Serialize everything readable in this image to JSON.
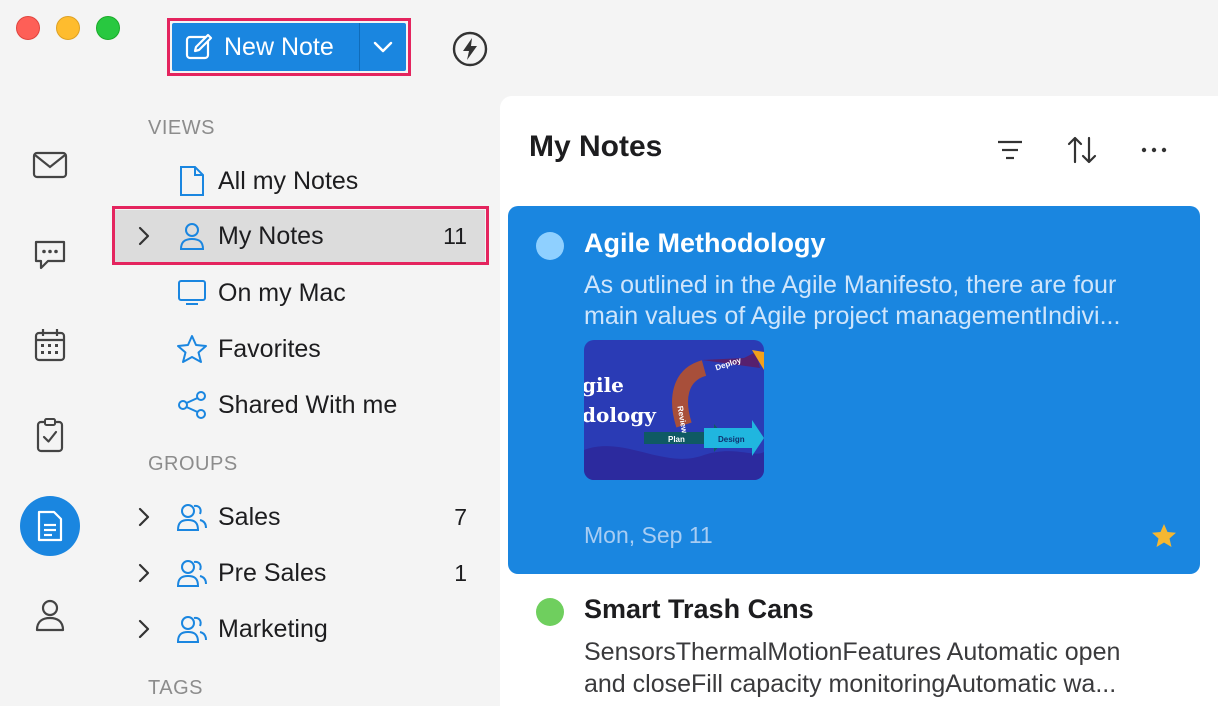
{
  "toolbar": {
    "new_note_label": "New Note"
  },
  "sidebar": {
    "views_header": "VIEWS",
    "views": [
      {
        "label": "All my Notes",
        "icon": "document-icon"
      },
      {
        "label": "My Notes",
        "icon": "person-icon",
        "count": "11"
      },
      {
        "label": "On my Mac",
        "icon": "monitor-icon"
      },
      {
        "label": "Favorites",
        "icon": "star-icon"
      },
      {
        "label": "Shared With me",
        "icon": "share-icon"
      }
    ],
    "groups_header": "GROUPS",
    "groups": [
      {
        "label": "Sales",
        "count": "7"
      },
      {
        "label": "Pre Sales",
        "count": "1"
      },
      {
        "label": "Marketing"
      }
    ],
    "tags_header": "TAGS"
  },
  "notes_panel": {
    "title": "My Notes",
    "notes": [
      {
        "title": "Agile Methodology",
        "snippet_line1": "As outlined in the Agile Manifesto, there are four",
        "snippet_line2": "main values of Agile project managementIndivi...",
        "date": "Mon, Sep 11",
        "favorite": true,
        "dot_color": "#8fd0ff",
        "thumbnail": {
          "text_line1": "gile",
          "text_line2": "dology",
          "labels": [
            "Deploy",
            "Review",
            "Plan",
            "Design"
          ]
        }
      },
      {
        "title": "Smart Trash Cans",
        "snippet_line1": "SensorsThermalMotionFeatures Automatic open",
        "snippet_line2": "and closeFill capacity monitoringAutomatic wa...",
        "dot_color": "#6fcf5e"
      }
    ]
  },
  "colors": {
    "accent": "#1a86e0",
    "highlight_outline": "#e4245e"
  }
}
